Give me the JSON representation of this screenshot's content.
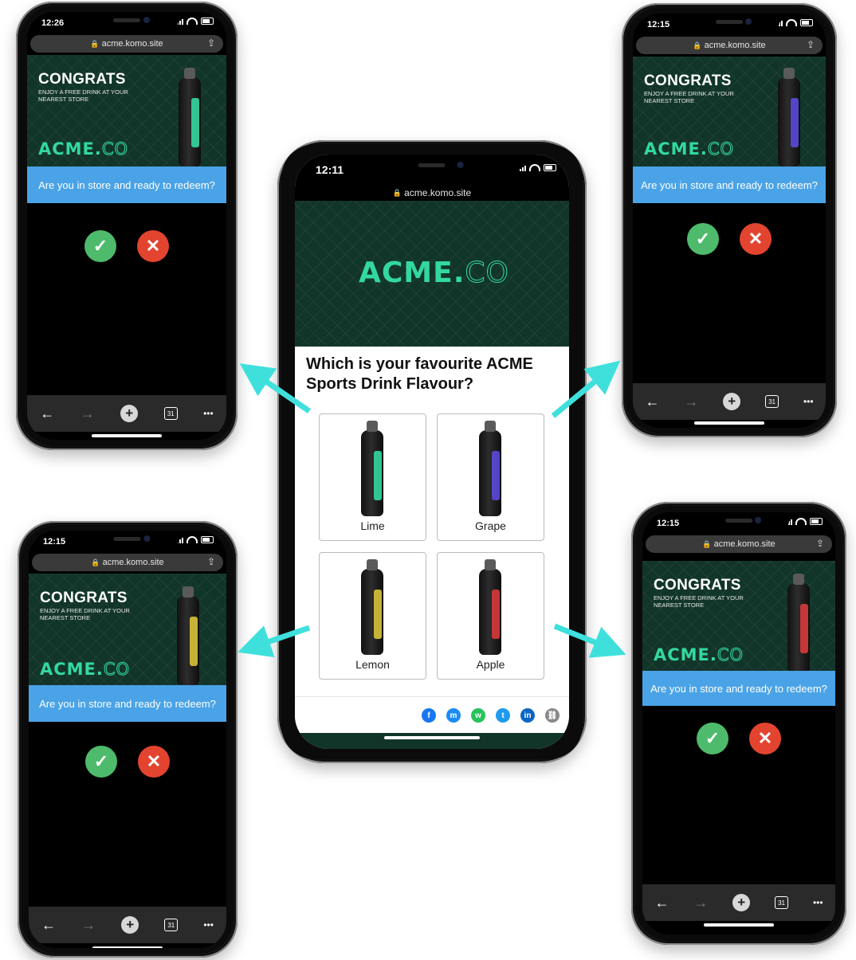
{
  "url": "acme.komo.site",
  "brand": {
    "name": "ACME.",
    "suffix": "CO"
  },
  "congrats": {
    "title": "CONGRATS",
    "subtitle": "ENJOY A FREE DRINK AT YOUR NEAREST STORE",
    "question": "Are you in store and ready to redeem?",
    "yes_icon": "✓",
    "no_icon": "✕"
  },
  "phones": {
    "top_left": {
      "time": "12:26",
      "flavour_color": "#33d8a0"
    },
    "top_right": {
      "time": "12:15",
      "flavour_color": "#5a4ad8"
    },
    "bottom_left": {
      "time": "12:15",
      "flavour_color": "#d8c23a"
    },
    "bottom_right": {
      "time": "12:15",
      "flavour_color": "#d83a3a"
    },
    "center": {
      "time": "12:11"
    }
  },
  "quiz": {
    "question": "Which is your favourite ACME Sports Drink Flavour?",
    "options": [
      {
        "label": "Lime",
        "color": "#33d8a0"
      },
      {
        "label": "Grape",
        "color": "#5a4ad8"
      },
      {
        "label": "Lemon",
        "color": "#d8c23a"
      },
      {
        "label": "Apple",
        "color": "#d83a3a"
      }
    ]
  },
  "toolbar": {
    "back": "←",
    "forward": "→",
    "new_tab": "+",
    "tab_count": "31",
    "more": "•••"
  },
  "share_icons": [
    {
      "name": "facebook-icon",
      "glyph": "f",
      "color": "#1877f2"
    },
    {
      "name": "messenger-icon",
      "glyph": "m",
      "color": "#1b8cf5"
    },
    {
      "name": "whatsapp-icon",
      "glyph": "w",
      "color": "#25c35a"
    },
    {
      "name": "twitter-icon",
      "glyph": "t",
      "color": "#1d9bf0"
    },
    {
      "name": "linkedin-icon",
      "glyph": "in",
      "color": "#0a66c2"
    },
    {
      "name": "link-icon",
      "glyph": "⛓",
      "color": "#888888"
    }
  ],
  "arrow_color": "#3fe0dc"
}
